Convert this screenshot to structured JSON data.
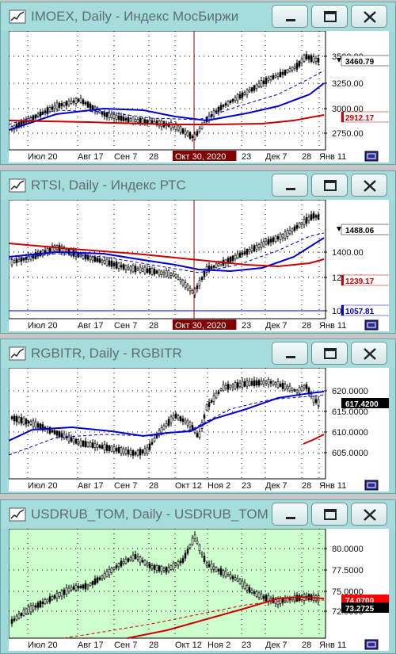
{
  "windows": [
    {
      "title": "IMOEX, Daily - Индекс МосБиржи",
      "bg": "#ffffff",
      "x_labels": [
        "Июл 20",
        "Авг 17",
        "Сен 7",
        "28",
        "Окт 30, 2020",
        "23",
        "Дек 7",
        "28",
        "Янв 11"
      ],
      "highlight_label": "Окт 30, 2020",
      "y_ticks": [
        "3500.00",
        "3250.00",
        "3000.00",
        "2750.00"
      ],
      "price_tags": [
        {
          "text": "3460.79",
          "bg": "#ffffff",
          "fg": "#000000"
        },
        {
          "text": "2912.17",
          "bg": "#ffffff",
          "fg": "#cc0000"
        }
      ]
    },
    {
      "title": "RTSI, Daily - Индекс РТС",
      "bg": "#ffffff",
      "x_labels": [
        "Июл 20",
        "Авг 17",
        "Сен 7",
        "28",
        "Окт 30, 2020",
        "23",
        "Дек 7",
        "28",
        "Янв 11"
      ],
      "highlight_label": "Окт 30, 2020",
      "y_ticks": [
        "1400.00",
        "1200.00",
        "1000.00"
      ],
      "price_tags": [
        {
          "text": "1488.06",
          "bg": "#ffffff",
          "fg": "#000000"
        },
        {
          "text": "1239.17",
          "bg": "#ffffff",
          "fg": "#cc0000"
        },
        {
          "text": "1057.81",
          "bg": "#ffffff",
          "fg": "#0000cc"
        }
      ]
    },
    {
      "title": "RGBITR, Daily - RGBITR",
      "bg": "#ffffff",
      "x_labels": [
        "Июл 20",
        "Авг 17",
        "Сен 7",
        "28",
        "Окт 12",
        "Ноя 2",
        "23",
        "Дек 7",
        "28",
        "Янв 11"
      ],
      "highlight_label": "",
      "y_ticks": [
        "620.0000",
        "615.0000",
        "610.0000",
        "605.0000"
      ],
      "price_tags": [
        {
          "text": "617.4200",
          "bg": "#000000",
          "fg": "#ffffff"
        }
      ]
    },
    {
      "title": "USDRUB_TOM, Daily - USDRUB_TOM",
      "bg": "#ccffcc",
      "x_labels": [
        "Июл 20",
        "Авг 17",
        "Сен 7",
        "28",
        "Окт 12",
        "Ноя 2",
        "23",
        "Дек 7",
        "28",
        "Янв 11"
      ],
      "highlight_label": "",
      "y_ticks": [
        "80.0000",
        "77.5000",
        "75.0000",
        "72.5000"
      ],
      "price_tags": [
        {
          "text": "74.0700",
          "bg": "#ff0000",
          "fg": "#ffffff"
        },
        {
          "text": "73.2725",
          "bg": "#000000",
          "fg": "#ffffff"
        }
      ]
    }
  ]
}
